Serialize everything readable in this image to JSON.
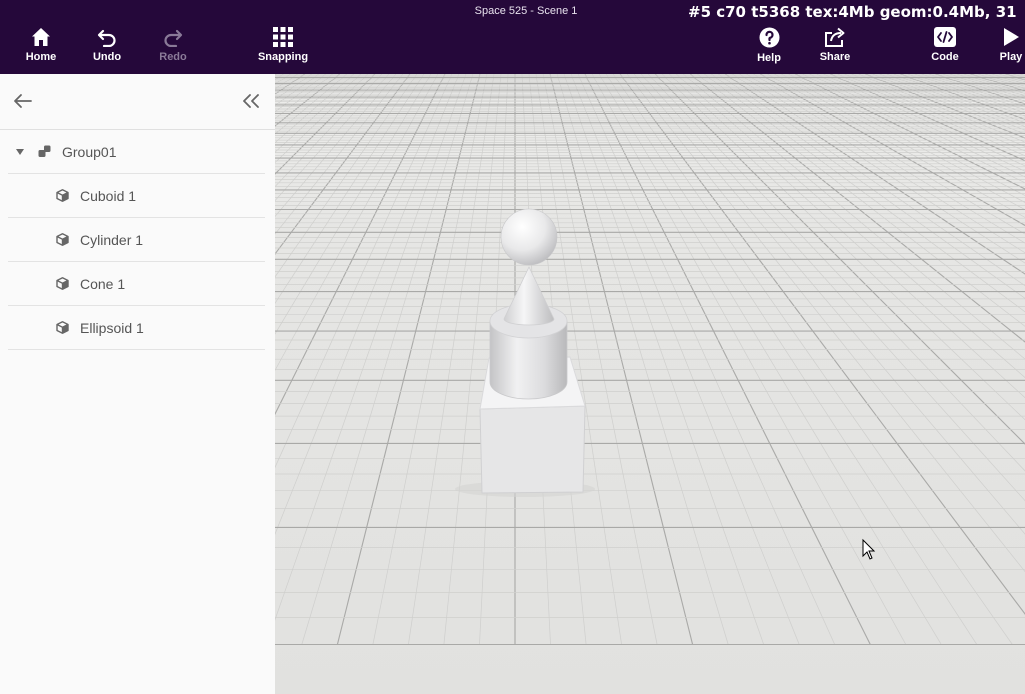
{
  "header": {
    "scene_title": "Space 525 - Scene 1",
    "stats": "#5  c70 t5368 tex:4Mb geom:0.4Mb, 31"
  },
  "toolbar": {
    "home": {
      "label": "Home",
      "icon": "home-icon"
    },
    "undo": {
      "label": "Undo",
      "icon": "undo-icon"
    },
    "redo": {
      "label": "Redo",
      "icon": "redo-icon"
    },
    "snapping": {
      "label": "Snapping",
      "icon": "grid-icon"
    },
    "help": {
      "label": "Help",
      "icon": "help-icon"
    },
    "share": {
      "label": "Share",
      "icon": "share-icon"
    },
    "code": {
      "label": "Code",
      "icon": "code-icon"
    },
    "play": {
      "label": "Play",
      "icon": "play-icon"
    }
  },
  "sidebar": {
    "group": {
      "label": "Group01",
      "icon": "group-icon"
    },
    "items": [
      {
        "label": "Cuboid 1",
        "icon": "cube-icon"
      },
      {
        "label": "Cylinder 1",
        "icon": "cube-icon"
      },
      {
        "label": "Cone 1",
        "icon": "cube-icon"
      },
      {
        "label": "Ellipsoid 1",
        "icon": "cube-icon"
      }
    ]
  },
  "colors": {
    "topbar_bg": "#25083a",
    "sidebar_bg": "#fafafa",
    "floor": "#e4e4e2",
    "grid_minor": "#cfcfcd",
    "grid_major": "#a9a9a7"
  }
}
